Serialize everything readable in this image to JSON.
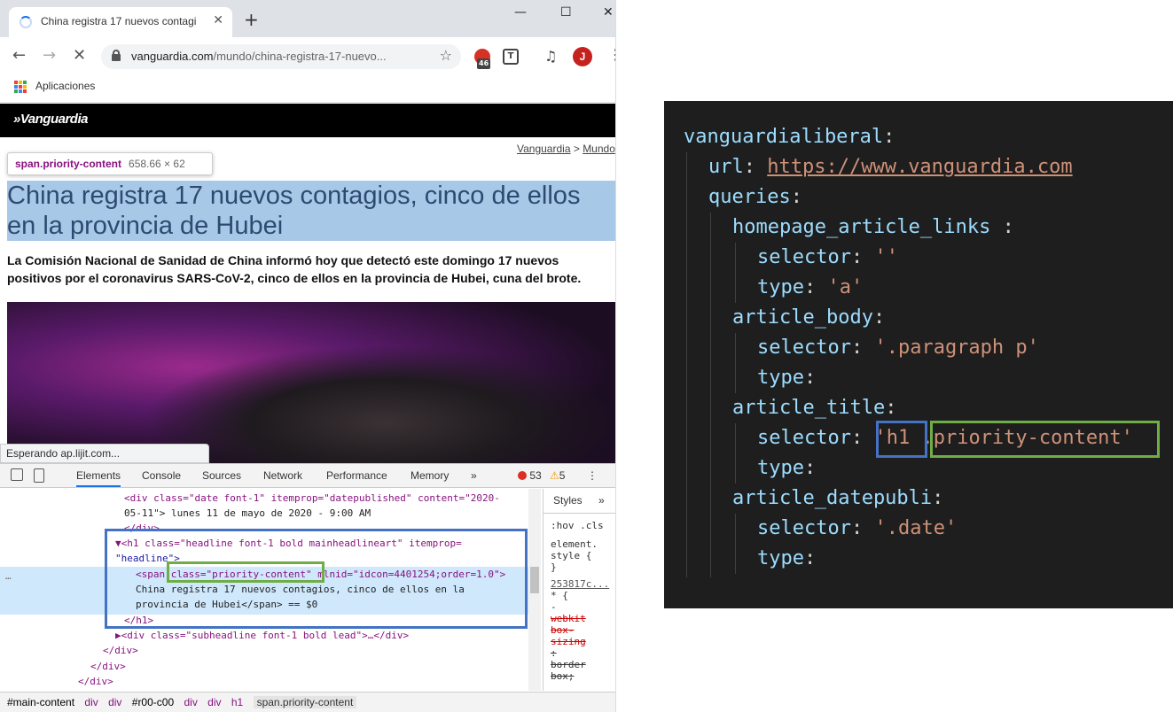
{
  "browser": {
    "tab_title": "China registra 17 nuevos contagi",
    "tab_close": "✕",
    "new_tab": "+",
    "window_minimize": "—",
    "window_maximize": "☐",
    "window_close": "✕",
    "url_host": "vanguardia.com",
    "url_path": "/mundo/china-registra-17-nuevo...",
    "ext_badge": "46",
    "avatar_initial": "J",
    "bookmarks_apps": "Aplicaciones"
  },
  "page": {
    "logo": "»Vanguardia",
    "breadcrumb_home": "Vanguardia",
    "breadcrumb_sep": " > ",
    "breadcrumb_section": "Mundo",
    "tooltip_selector": "span.priority-content",
    "tooltip_size": "658.66 × 62",
    "headline_line1": "China registra 17 nuevos contagios, cinco de ellos",
    "headline_line2": "en la provincia de Hubei",
    "lead_line1": "La Comisión Nacional de Sanidad de China informó hoy que detectó este domingo 17 nuevos",
    "lead_line2": "positivos por el coronavirus SARS-CoV-2, cinco de ellos en la provincia de Hubei, cuna del brote.",
    "status": "Esperando ap.lijit.com..."
  },
  "devtools": {
    "tabs": [
      "Elements",
      "Console",
      "Sources",
      "Network",
      "Performance",
      "Memory"
    ],
    "more": "»",
    "errors": "53",
    "warnings": "5",
    "styles_tab": "Styles",
    "styles_more": "»",
    "styles_lines": [
      ":hov .cls",
      "element.",
      "style {",
      "}",
      "253817c...",
      "* {",
      "-",
      "webkit",
      "box-",
      "sizing",
      ":",
      "border",
      "box;"
    ],
    "breadcrumbs": [
      "#main-content",
      "div",
      "div",
      "#r00-c00",
      "div",
      "div",
      "h1",
      "span.priority-content"
    ],
    "code": {
      "l1_attrs": "<div class=\"date font-1\" itemprop=\"datepublished\" content=\"2020-",
      "l2": "05-11\"> lunes 11 de mayo de 2020 - 9:00 AM",
      "l3": "</div>",
      "l4": "▼<h1 class=\"headline font-1 bold mainheadlineart\" itemprop=",
      "l5": "\"headline\">",
      "l6": "<span class=\"priority-content\" mlnid=\"idcon=4401254;order=1.0\">",
      "l7": "China registra 17 nuevos contagios, cinco de ellos en la",
      "l8": "provincia de Hubei</span> == $0",
      "l9": "</h1>",
      "l10": "▶<div class=\"subheadline font-1 bold lead\">…</div>",
      "l11": "</div>",
      "l12": "</div>",
      "l13": "</div>"
    }
  },
  "yaml": {
    "root": "vanguardialiberal",
    "url_key": "url",
    "url_value": "https://www.vanguardia.com",
    "queries_key": "queries",
    "sections": [
      {
        "name": "homepage_article_links",
        "name_suffix": " :",
        "selector": "''",
        "type": "'a'"
      },
      {
        "name": "article_body",
        "name_suffix": ":",
        "selector": "'.paragraph p'",
        "type": ""
      },
      {
        "name": "article_title",
        "name_suffix": ":",
        "selector_a": "'h1",
        "selector_b": " .priority-content'",
        "type": ""
      },
      {
        "name": "article_datepubli",
        "name_suffix": ":",
        "selector": "'.date'",
        "type": ""
      }
    ],
    "selector_key": "selector",
    "type_key": "type",
    "colon": ":"
  },
  "colors": {
    "highlight_blue": "#4472c4",
    "highlight_green": "#70ad47",
    "editor_bg": "#1e1e1e"
  }
}
